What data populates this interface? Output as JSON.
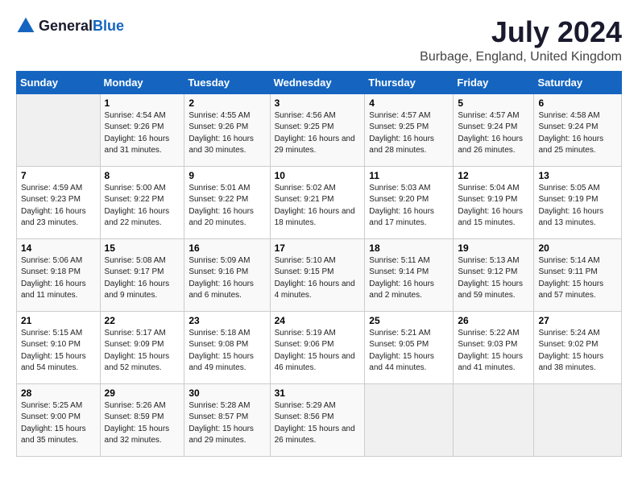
{
  "header": {
    "logo_general": "General",
    "logo_blue": "Blue",
    "title": "July 2024",
    "location": "Burbage, England, United Kingdom"
  },
  "days_of_week": [
    "Sunday",
    "Monday",
    "Tuesday",
    "Wednesday",
    "Thursday",
    "Friday",
    "Saturday"
  ],
  "weeks": [
    [
      {
        "number": "",
        "sunrise": "",
        "sunset": "",
        "daylight": ""
      },
      {
        "number": "1",
        "sunrise": "4:54 AM",
        "sunset": "9:26 PM",
        "daylight": "16 hours and 31 minutes."
      },
      {
        "number": "2",
        "sunrise": "4:55 AM",
        "sunset": "9:26 PM",
        "daylight": "16 hours and 30 minutes."
      },
      {
        "number": "3",
        "sunrise": "4:56 AM",
        "sunset": "9:25 PM",
        "daylight": "16 hours and 29 minutes."
      },
      {
        "number": "4",
        "sunrise": "4:57 AM",
        "sunset": "9:25 PM",
        "daylight": "16 hours and 28 minutes."
      },
      {
        "number": "5",
        "sunrise": "4:57 AM",
        "sunset": "9:24 PM",
        "daylight": "16 hours and 26 minutes."
      },
      {
        "number": "6",
        "sunrise": "4:58 AM",
        "sunset": "9:24 PM",
        "daylight": "16 hours and 25 minutes."
      }
    ],
    [
      {
        "number": "7",
        "sunrise": "4:59 AM",
        "sunset": "9:23 PM",
        "daylight": "16 hours and 23 minutes."
      },
      {
        "number": "8",
        "sunrise": "5:00 AM",
        "sunset": "9:22 PM",
        "daylight": "16 hours and 22 minutes."
      },
      {
        "number": "9",
        "sunrise": "5:01 AM",
        "sunset": "9:22 PM",
        "daylight": "16 hours and 20 minutes."
      },
      {
        "number": "10",
        "sunrise": "5:02 AM",
        "sunset": "9:21 PM",
        "daylight": "16 hours and 18 minutes."
      },
      {
        "number": "11",
        "sunrise": "5:03 AM",
        "sunset": "9:20 PM",
        "daylight": "16 hours and 17 minutes."
      },
      {
        "number": "12",
        "sunrise": "5:04 AM",
        "sunset": "9:19 PM",
        "daylight": "16 hours and 15 minutes."
      },
      {
        "number": "13",
        "sunrise": "5:05 AM",
        "sunset": "9:19 PM",
        "daylight": "16 hours and 13 minutes."
      }
    ],
    [
      {
        "number": "14",
        "sunrise": "5:06 AM",
        "sunset": "9:18 PM",
        "daylight": "16 hours and 11 minutes."
      },
      {
        "number": "15",
        "sunrise": "5:08 AM",
        "sunset": "9:17 PM",
        "daylight": "16 hours and 9 minutes."
      },
      {
        "number": "16",
        "sunrise": "5:09 AM",
        "sunset": "9:16 PM",
        "daylight": "16 hours and 6 minutes."
      },
      {
        "number": "17",
        "sunrise": "5:10 AM",
        "sunset": "9:15 PM",
        "daylight": "16 hours and 4 minutes."
      },
      {
        "number": "18",
        "sunrise": "5:11 AM",
        "sunset": "9:14 PM",
        "daylight": "16 hours and 2 minutes."
      },
      {
        "number": "19",
        "sunrise": "5:13 AM",
        "sunset": "9:12 PM",
        "daylight": "15 hours and 59 minutes."
      },
      {
        "number": "20",
        "sunrise": "5:14 AM",
        "sunset": "9:11 PM",
        "daylight": "15 hours and 57 minutes."
      }
    ],
    [
      {
        "number": "21",
        "sunrise": "5:15 AM",
        "sunset": "9:10 PM",
        "daylight": "15 hours and 54 minutes."
      },
      {
        "number": "22",
        "sunrise": "5:17 AM",
        "sunset": "9:09 PM",
        "daylight": "15 hours and 52 minutes."
      },
      {
        "number": "23",
        "sunrise": "5:18 AM",
        "sunset": "9:08 PM",
        "daylight": "15 hours and 49 minutes."
      },
      {
        "number": "24",
        "sunrise": "5:19 AM",
        "sunset": "9:06 PM",
        "daylight": "15 hours and 46 minutes."
      },
      {
        "number": "25",
        "sunrise": "5:21 AM",
        "sunset": "9:05 PM",
        "daylight": "15 hours and 44 minutes."
      },
      {
        "number": "26",
        "sunrise": "5:22 AM",
        "sunset": "9:03 PM",
        "daylight": "15 hours and 41 minutes."
      },
      {
        "number": "27",
        "sunrise": "5:24 AM",
        "sunset": "9:02 PM",
        "daylight": "15 hours and 38 minutes."
      }
    ],
    [
      {
        "number": "28",
        "sunrise": "5:25 AM",
        "sunset": "9:00 PM",
        "daylight": "15 hours and 35 minutes."
      },
      {
        "number": "29",
        "sunrise": "5:26 AM",
        "sunset": "8:59 PM",
        "daylight": "15 hours and 32 minutes."
      },
      {
        "number": "30",
        "sunrise": "5:28 AM",
        "sunset": "8:57 PM",
        "daylight": "15 hours and 29 minutes."
      },
      {
        "number": "31",
        "sunrise": "5:29 AM",
        "sunset": "8:56 PM",
        "daylight": "15 hours and 26 minutes."
      },
      {
        "number": "",
        "sunrise": "",
        "sunset": "",
        "daylight": ""
      },
      {
        "number": "",
        "sunrise": "",
        "sunset": "",
        "daylight": ""
      },
      {
        "number": "",
        "sunrise": "",
        "sunset": "",
        "daylight": ""
      }
    ]
  ],
  "labels": {
    "sunrise_prefix": "Sunrise: ",
    "sunset_prefix": "Sunset: ",
    "daylight_prefix": "Daylight: "
  }
}
